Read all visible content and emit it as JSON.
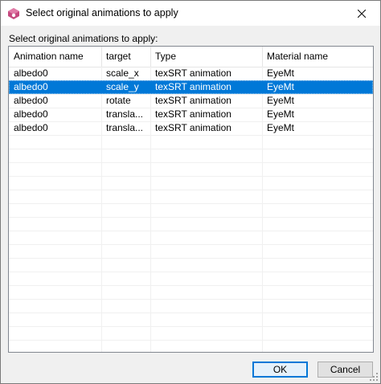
{
  "window": {
    "title": "Select original animations to apply",
    "close_glyph": "✕"
  },
  "caption": "Select original animations to apply:",
  "listview": {
    "columns": [
      "Animation name",
      "target",
      "Type",
      "Material name"
    ],
    "rows": [
      {
        "cells": [
          "albedo0",
          "scale_x",
          "texSRT animation",
          "EyeMt"
        ],
        "selected": false
      },
      {
        "cells": [
          "albedo0",
          "scale_y",
          "texSRT animation",
          "EyeMt"
        ],
        "selected": true
      },
      {
        "cells": [
          "albedo0",
          "rotate",
          "texSRT animation",
          "EyeMt"
        ],
        "selected": false
      },
      {
        "cells": [
          "albedo0",
          "transla...",
          "texSRT animation",
          "EyeMt"
        ],
        "selected": false
      },
      {
        "cells": [
          "albedo0",
          "transla...",
          "texSRT animation",
          "EyeMt"
        ],
        "selected": false
      }
    ]
  },
  "buttons": {
    "ok": "OK",
    "cancel": "Cancel"
  },
  "colors": {
    "selection": "#0078d7",
    "app_icon": "#c5487e"
  }
}
